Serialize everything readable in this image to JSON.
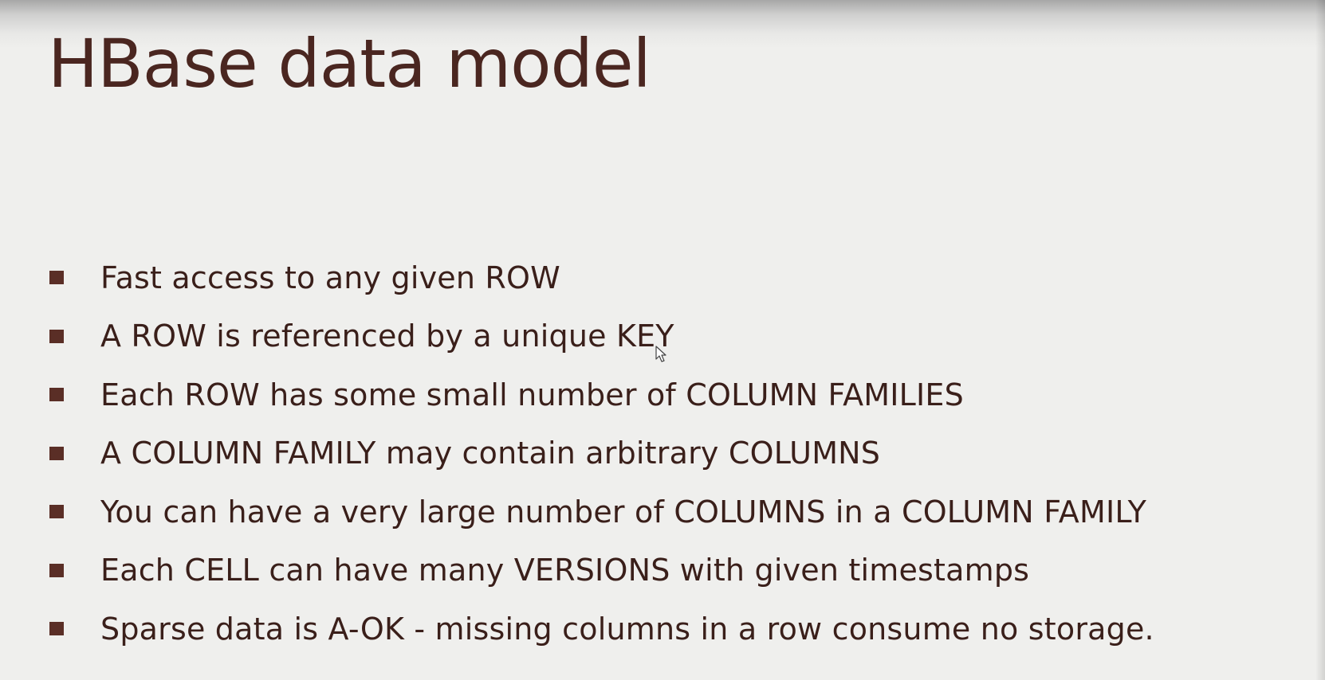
{
  "slide": {
    "title": "HBase data model",
    "bullets": [
      "Fast access to any given ROW",
      "A ROW is referenced by a unique KEY",
      "Each ROW has some small number of COLUMN FAMILIES",
      "A COLUMN FAMILY may contain arbitrary COLUMNS",
      "You can have a very large number of COLUMNS in a COLUMN FAMILY",
      "Each CELL can have many VERSIONS with given timestamps",
      "Sparse data is A-OK - missing columns in a row consume no storage."
    ]
  },
  "colors": {
    "background": "#efefed",
    "title": "#4a2620",
    "text": "#3a1f1a",
    "bullet": "#5a2e26"
  },
  "icons": {
    "cursor": "mouse-pointer-icon",
    "bullet": "square-bullet-icon"
  }
}
